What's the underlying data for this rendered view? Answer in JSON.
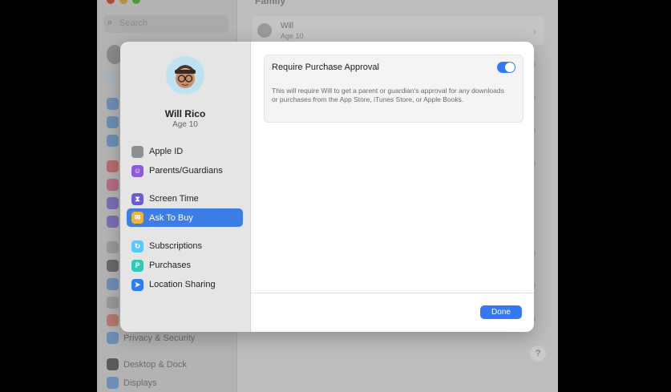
{
  "background": {
    "search_placeholder": "Search",
    "family_title": "Family",
    "member": {
      "name": "Will",
      "age": "Age 10"
    },
    "sidebar_items": [
      {
        "label": "Privacy & Security"
      },
      {
        "label": "Desktop & Dock"
      },
      {
        "label": "Displays"
      }
    ],
    "help_label": "?"
  },
  "sheet": {
    "user": {
      "name": "Will Rico",
      "age": "Age 10"
    },
    "nav": [
      {
        "label": "Apple ID",
        "icon": "apple-icon",
        "color": "#8e8e93",
        "glyph": ""
      },
      {
        "label": "Parents/Guardians",
        "icon": "parents-icon",
        "color": "#8e5bd6",
        "glyph": "👪"
      },
      {
        "label": "Screen Time",
        "icon": "hourglass-icon",
        "color": "#6b5bd6",
        "glyph": "⌛"
      },
      {
        "label": "Ask To Buy",
        "icon": "ask-to-buy-icon",
        "color": "#f0b33a",
        "glyph": "✉",
        "selected": true
      },
      {
        "label": "Subscriptions",
        "icon": "subscriptions-icon",
        "color": "#5ac8fa",
        "glyph": "↻"
      },
      {
        "label": "Purchases",
        "icon": "purchases-icon",
        "color": "#34c7b5",
        "glyph": "P"
      },
      {
        "label": "Location Sharing",
        "icon": "location-arrow-icon",
        "color": "#2f7cf6",
        "glyph": "➤"
      }
    ],
    "panel": {
      "title": "Require Purchase Approval",
      "toggle_on": true,
      "description": "This will require Will to get a parent or guardian's approval for any downloads or purchases from the App Store, iTunes Store, or Apple Books."
    },
    "done_label": "Done"
  },
  "colors": {
    "accent": "#3478f6",
    "selected": "#3d7de6"
  }
}
